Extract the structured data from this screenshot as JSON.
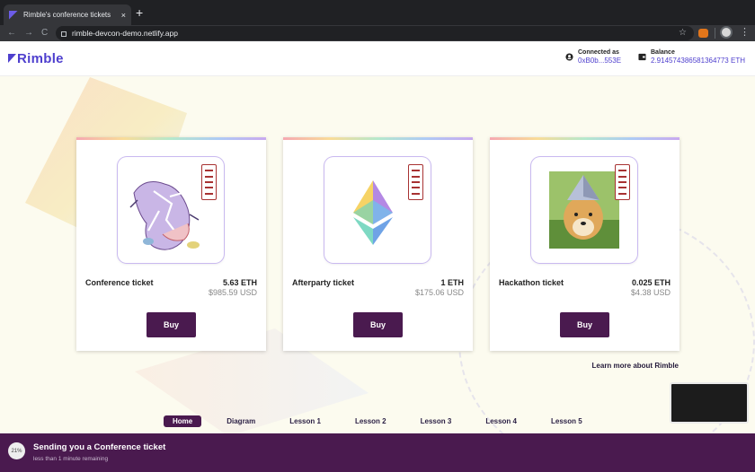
{
  "browser": {
    "tab_title": "Rimble's conference tickets",
    "tab_close": "×",
    "new_tab": "+",
    "url": "rimble-devcon-demo.netlify.app",
    "back": "←",
    "forward": "→",
    "reload": "C",
    "star": "☆",
    "menu": "⋮"
  },
  "header": {
    "logo": "Rimble",
    "connected_label": "Connected as",
    "connected_value": "0xB0b...553E",
    "balance_label": "Balance",
    "balance_value": "2.914574386581364773 ETH"
  },
  "tickets": [
    {
      "name": "Conference ticket",
      "eth": "5.63 ETH",
      "usd": "$985.59 USD",
      "buy": "Buy",
      "image": "skeleton-art-image"
    },
    {
      "name": "Afterparty ticket",
      "eth": "1 ETH",
      "usd": "$175.06 USD",
      "buy": "Buy",
      "image": "ethereum-logo-image"
    },
    {
      "name": "Hackathon ticket",
      "eth": "0.025 ETH",
      "usd": "$4.38 USD",
      "buy": "Buy",
      "image": "doge-image"
    }
  ],
  "learn_more": "Learn more about Rimble",
  "lessons": [
    "Home",
    "Diagram",
    "Lesson 1",
    "Lesson 2",
    "Lesson 3",
    "Lesson 4",
    "Lesson 5"
  ],
  "toast": {
    "progress": "21%",
    "title": "Sending you a Conference ticket",
    "subtitle": "less than 1 minute remaining"
  },
  "colors": {
    "brand": "#4e3fce",
    "button": "#4a1a4f",
    "toast_bg": "#4a1a4f",
    "page_bg": "#fcfbef"
  }
}
